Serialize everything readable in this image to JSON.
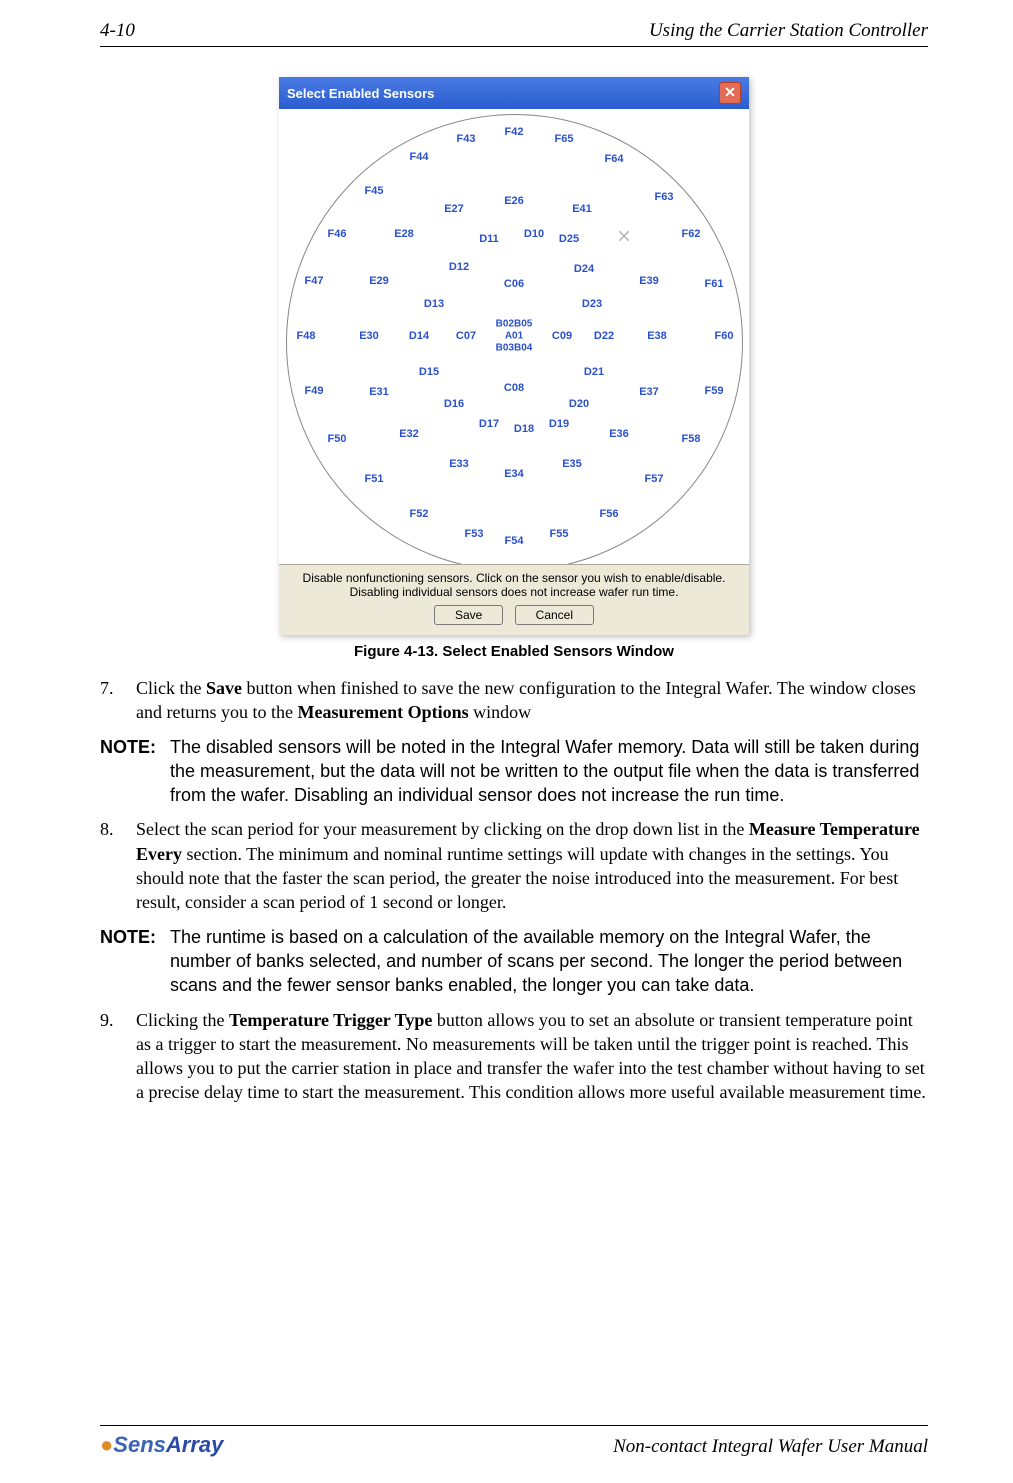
{
  "header": {
    "left": "4-10",
    "right": "Using the Carrier Station Controller"
  },
  "dialog": {
    "title": "Select Enabled Sensors",
    "close_glyph": "✕",
    "hint": "Disable nonfunctioning sensors. Click on the sensor you wish to enable/disable. Disabling individual sensors does not increase wafer run time.",
    "save_label": "Save",
    "cancel_label": "Cancel",
    "x_mark": "✕",
    "sensors": {
      "center1": "B02B05",
      "center2": "A01",
      "center3": "B03B04",
      "c06": "C06",
      "c07": "C07",
      "c08": "C08",
      "c09": "C09",
      "d10": "D10",
      "d11": "D11",
      "d12": "D12",
      "d13": "D13",
      "d14": "D14",
      "d15": "D15",
      "d16": "D16",
      "d17": "D17",
      "d18": "D18",
      "d19": "D19",
      "d20": "D20",
      "d21": "D21",
      "d22": "D22",
      "d23": "D23",
      "d24": "D24",
      "d25": "D25",
      "e26": "E26",
      "e27": "E27",
      "e28": "E28",
      "e29": "E29",
      "e30": "E30",
      "e31": "E31",
      "e32": "E32",
      "e33": "E33",
      "e34": "E34",
      "e35": "E35",
      "e36": "E36",
      "e37": "E37",
      "e38": "E38",
      "e39": "E39",
      "e41": "E41",
      "f42": "F42",
      "f43": "F43",
      "f44": "F44",
      "f45": "F45",
      "f46": "F46",
      "f47": "F47",
      "f48": "F48",
      "f49": "F49",
      "f50": "F50",
      "f51": "F51",
      "f52": "F52",
      "f53": "F53",
      "f54": "F54",
      "f55": "F55",
      "f56": "F56",
      "f57": "F57",
      "f58": "F58",
      "f59": "F59",
      "f60": "F60",
      "f61": "F61",
      "f62": "F62",
      "f63": "F63",
      "f64": "F64",
      "f65": "F65"
    }
  },
  "caption": "Figure 4-13. Select Enabled Sensors Window",
  "body": {
    "item7_num": "7.",
    "item7_a": "Click the ",
    "item7_save": "Save",
    "item7_b": " button when finished to save the new configuration to the Integral Wafer. The window closes and returns you to the ",
    "item7_mo": "Measurement Options",
    "item7_c": " window",
    "note1_lbl": "NOTE:",
    "note1": "The disabled sensors will be noted in the Integral Wafer memory. Data will still be taken during the measurement, but the data will not be written to the output file when the data is transferred from the wafer. Disabling an individual sensor does not increase the run time.",
    "item8_num": "8.",
    "item8_a": "Select the scan period for your measurement by clicking on the drop down list in the ",
    "item8_mte": "Measure Temperature Every",
    "item8_b": " section. The minimum and nominal runtime settings will update with changes in the settings. You should note that the faster the scan period, the greater the noise introduced into the measurement. For best result, consider a scan period of 1 second or longer.",
    "note2_lbl": "NOTE:",
    "note2": "The runtime is based on a calculation of the available memory on the Integral Wafer, the number of banks selected, and number of scans per second. The longer the period between scans and the fewer sensor banks enabled, the longer you can take data.",
    "item9_num": "9.",
    "item9_a": "Clicking the ",
    "item9_ttt": "Temperature Trigger Type",
    "item9_b": " button allows you to set an absolute or transient temperature point as a trigger to start the measurement. No measurements will be taken until the trigger point is reached. This allows you to put the carrier station in place and transfer the wafer into the test chamber without having to set a precise delay time to start the measurement. This condition allows more useful available measurement time."
  },
  "footer": {
    "logo_a": "Sens",
    "logo_b": "Array",
    "right": "Non-contact Integral Wafer User Manual"
  }
}
